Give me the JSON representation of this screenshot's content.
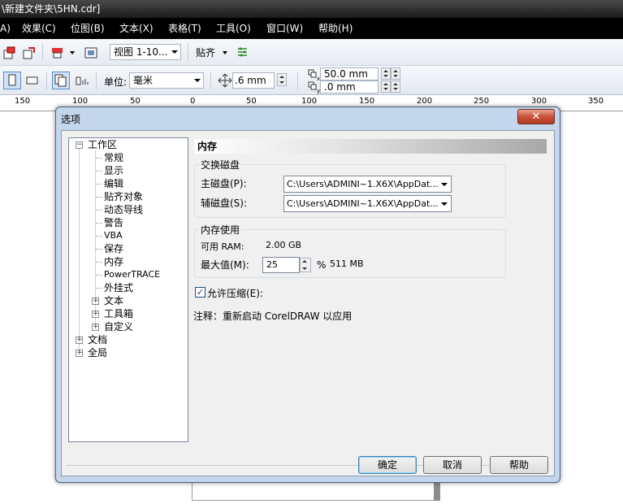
{
  "app": {
    "title": "\\新建文件夹\\5HN.cdr]"
  },
  "menu": [
    "效果(C)",
    "位图(B)",
    "文本(X)",
    "表格(T)",
    "工具(O)",
    "窗口(W)",
    "帮助(H)"
  ],
  "toolbar": {
    "view_combo": "视图 1-10...",
    "snap_label": "贴齐",
    "unit_label": "单位:",
    "unit_value": "毫米",
    "nudge_value": ".6 mm",
    "dup_x": "50.0 mm",
    "dup_y": ".0 mm"
  },
  "ruler": [
    "150",
    "100",
    "50",
    "0",
    "50",
    "100",
    "150",
    "200",
    "250",
    "300",
    "350"
  ],
  "dialog": {
    "title": "选项",
    "close": "✕",
    "tree": {
      "workspace": "工作区",
      "children": [
        "常规",
        "显示",
        "编辑",
        "贴齐对象",
        "动态导线",
        "警告",
        "VBA",
        "保存",
        "内存",
        "PowerTRACE",
        "外挂式"
      ],
      "expandable": [
        "文本",
        "工具箱",
        "自定义"
      ],
      "document": "文档",
      "global": "全局"
    },
    "panel_title": "内存",
    "swap": {
      "title": "交换磁盘",
      "primary_label": "主磁盘(P):",
      "primary_value": "C:\\Users\\ADMINI~1.X6X\\AppDat...",
      "secondary_label": "辅磁盘(S):",
      "secondary_value": "C:\\Users\\ADMINI~1.X6X\\AppDat..."
    },
    "memory": {
      "title": "内存使用",
      "ram_label": "可用 RAM:",
      "ram_value": "2.00 GB",
      "max_label": "最大值(M):",
      "max_value": "25",
      "percent": "%",
      "max_mb": "511 MB"
    },
    "compress_label": "允许压缩(E):",
    "compress_checked": true,
    "note": "注释：重新启动 CorelDRAW 以应用",
    "buttons": {
      "ok": "确定",
      "cancel": "取消",
      "help": "帮助"
    }
  }
}
